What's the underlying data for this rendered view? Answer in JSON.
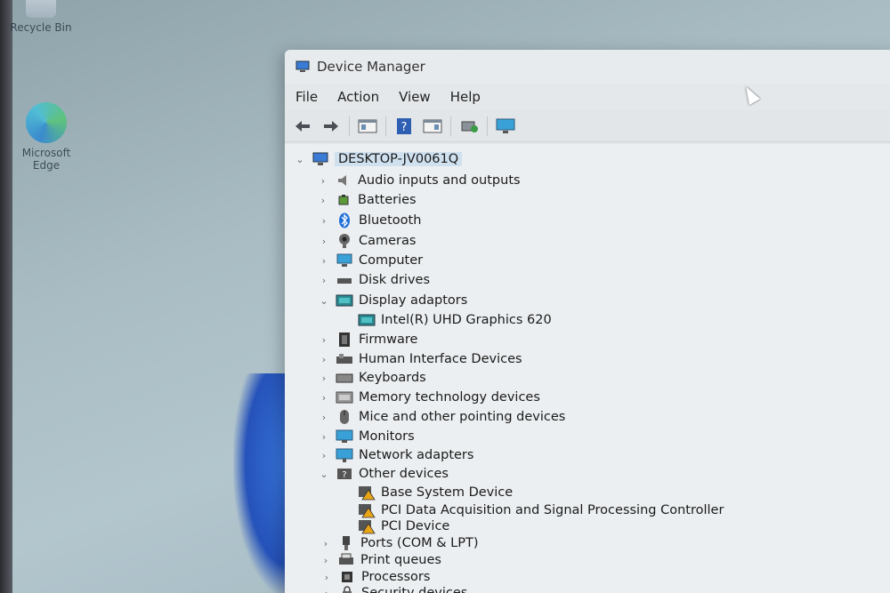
{
  "desktop": {
    "recycle_bin_label": "Recycle Bin",
    "edge_label_line1": "Microsoft",
    "edge_label_line2": "Edge"
  },
  "window": {
    "title": "Device Manager"
  },
  "menu": [
    "File",
    "Action",
    "View",
    "Help"
  ],
  "toolbar": [
    "back-arrow-icon",
    "forward-arrow-icon",
    "properties-icon",
    "help-icon",
    "view-icon",
    "scan-hardware-icon",
    "monitor-icon"
  ],
  "tree": {
    "root": "DESKTOP-JV0061Q",
    "items": [
      {
        "label": "Audio inputs and outputs",
        "state": "collapsed",
        "icon": "speaker-icon"
      },
      {
        "label": "Batteries",
        "state": "collapsed",
        "icon": "battery-icon"
      },
      {
        "label": "Bluetooth",
        "state": "collapsed",
        "icon": "bluetooth-icon"
      },
      {
        "label": "Cameras",
        "state": "collapsed",
        "icon": "camera-icon"
      },
      {
        "label": "Computer",
        "state": "collapsed",
        "icon": "computer-icon"
      },
      {
        "label": "Disk drives",
        "state": "collapsed",
        "icon": "disk-icon"
      },
      {
        "label": "Display adaptors",
        "state": "expanded",
        "icon": "display-adapter-icon",
        "children": [
          {
            "label": "Intel(R) UHD Graphics 620",
            "icon": "display-adapter-icon"
          }
        ]
      },
      {
        "label": "Firmware",
        "state": "collapsed",
        "icon": "firmware-icon"
      },
      {
        "label": "Human Interface Devices",
        "state": "collapsed",
        "icon": "hid-icon"
      },
      {
        "label": "Keyboards",
        "state": "collapsed",
        "icon": "keyboard-icon"
      },
      {
        "label": "Memory technology devices",
        "state": "collapsed",
        "icon": "memory-icon"
      },
      {
        "label": "Mice and other pointing devices",
        "state": "collapsed",
        "icon": "mouse-icon"
      },
      {
        "label": "Monitors",
        "state": "collapsed",
        "icon": "monitor-icon"
      },
      {
        "label": "Network adapters",
        "state": "collapsed",
        "icon": "network-icon"
      },
      {
        "label": "Other devices",
        "state": "expanded",
        "icon": "other-devices-icon",
        "children": [
          {
            "label": "Base System Device",
            "icon": "warning-device-icon"
          },
          {
            "label": "PCI Data Acquisition and Signal Processing Controller",
            "icon": "warning-device-icon"
          },
          {
            "label": "PCI Device",
            "icon": "warning-device-icon"
          }
        ]
      },
      {
        "label": "Ports (COM & LPT)",
        "state": "collapsed",
        "icon": "port-icon"
      },
      {
        "label": "Print queues",
        "state": "collapsed",
        "icon": "printer-icon"
      },
      {
        "label": "Processors",
        "state": "collapsed",
        "icon": "processor-icon"
      },
      {
        "label": "Security devices",
        "state": "collapsed",
        "icon": "security-icon"
      }
    ]
  }
}
